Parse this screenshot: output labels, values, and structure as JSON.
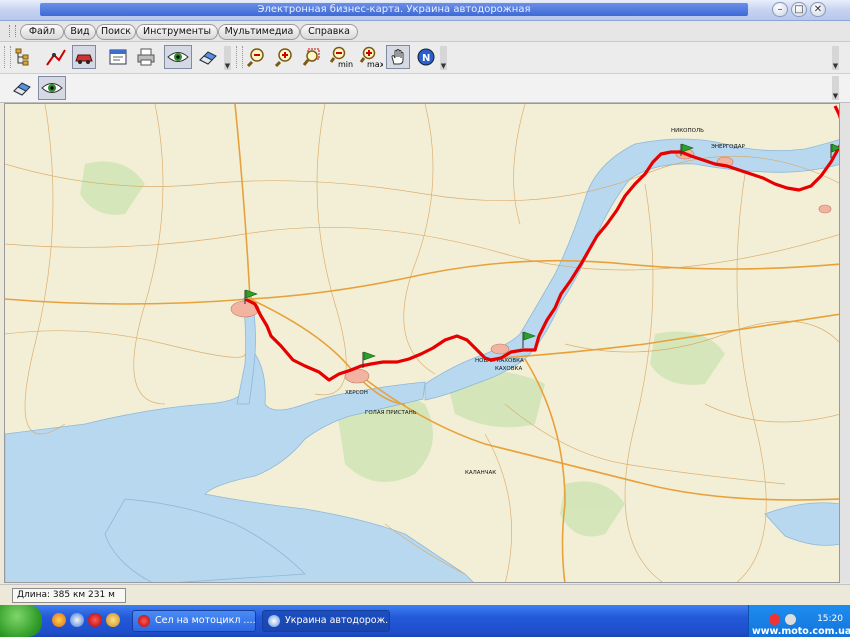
{
  "window": {
    "title": "Электронная бизнес-карта. Украина автодорожная"
  },
  "menu": {
    "items": [
      "Файл",
      "Вид",
      "Поиск",
      "Инструменты",
      "Мультимедиа",
      "Справка"
    ]
  },
  "toolbar": {
    "zoom_min_label": "min",
    "zoom_max_label": "max",
    "north_label": "N"
  },
  "map": {
    "route_color": "#e60000",
    "water_color": "#b7d8ee",
    "land_color": "#f3efd6",
    "field_color": "#c8e0b0",
    "labels": {
      "kherson": "ХЕРСОН",
      "nikopol": "НИКОПОЛЬ",
      "energodar": "ЭНЕРГОДАР",
      "kakhovka": "КАХОВКА",
      "nova_kakhovka": "НОВАЯ КАХОВКА",
      "kalanchak": "КАЛАНЧАК",
      "golaya_pristan": "ГОЛАЯ ПРИСТАНЬ"
    }
  },
  "status": {
    "length": "Длина: 385 км 231 м"
  },
  "taskbar": {
    "tasks": [
      "Сел на мотоцикл ........",
      "Украина автодорож..."
    ],
    "clock": "15:20"
  },
  "watermark": "www.moto.com.ua"
}
